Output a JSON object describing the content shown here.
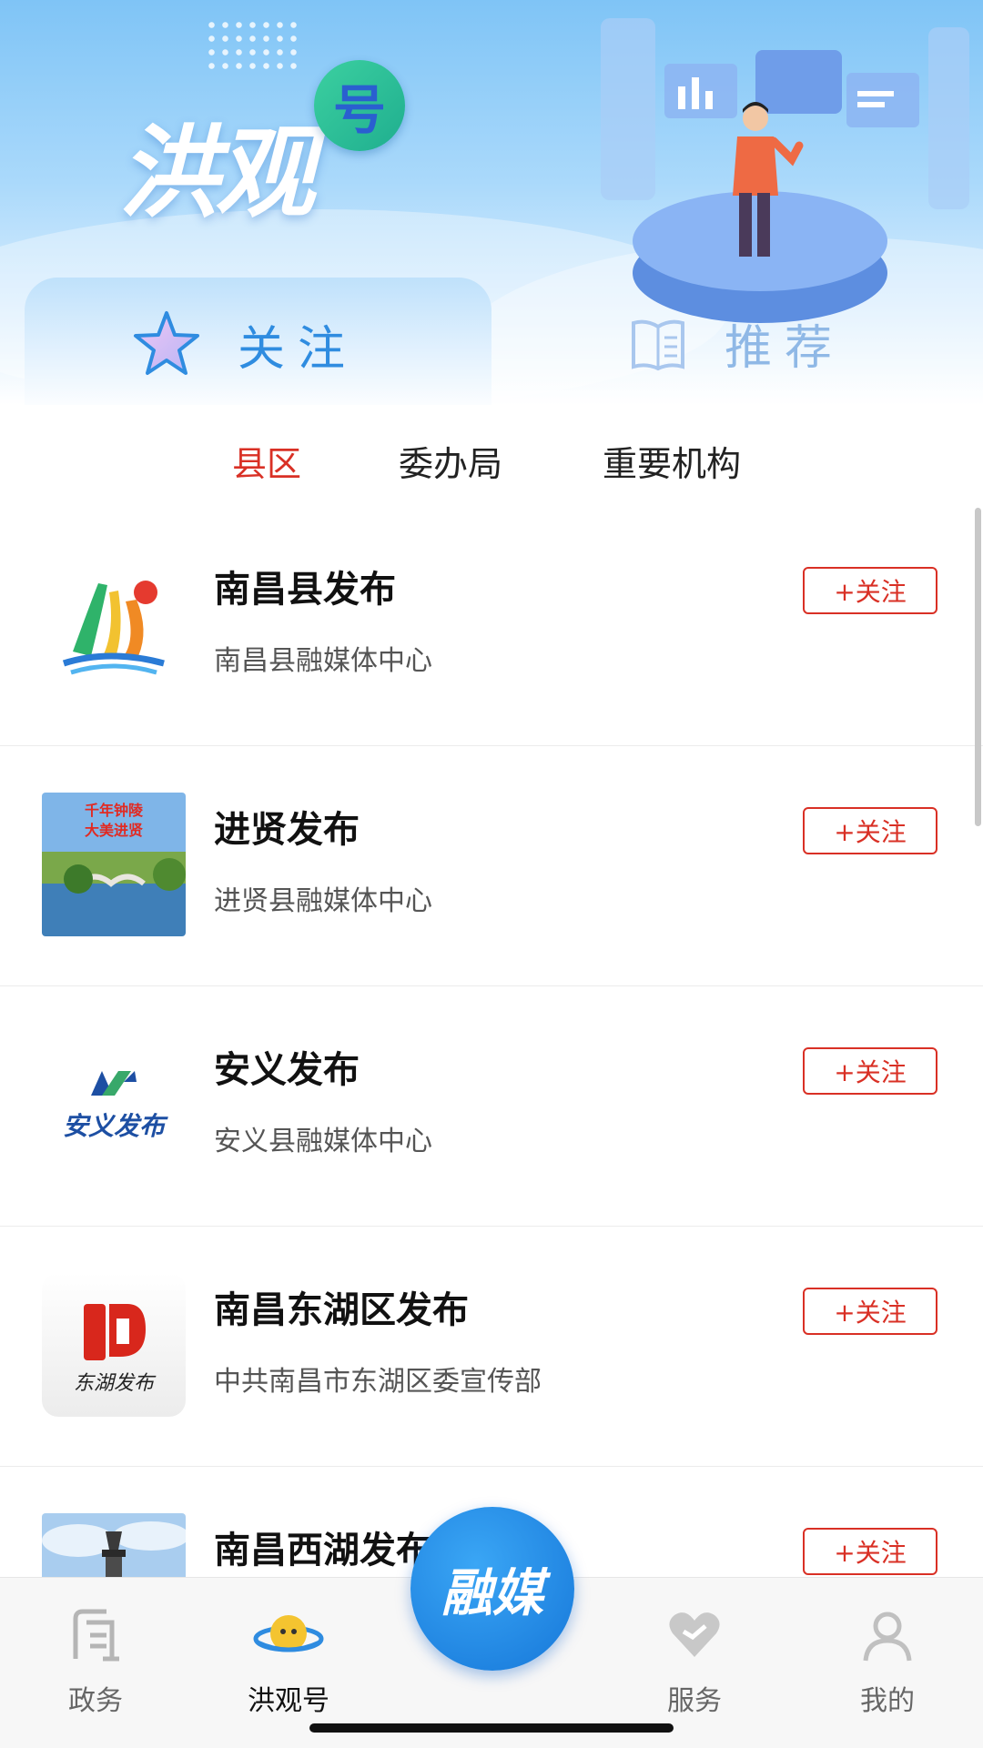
{
  "header": {
    "logo_text": "洪观",
    "logo_badge": "号",
    "tabs": [
      {
        "label": "关注",
        "icon": "star-icon",
        "active": true
      },
      {
        "label": "推荐",
        "icon": "book-icon",
        "active": false
      }
    ]
  },
  "subtabs": [
    {
      "label": "县区",
      "active": true
    },
    {
      "label": "委办局",
      "active": false
    },
    {
      "label": "重要机构",
      "active": false
    }
  ],
  "accounts": [
    {
      "name": "南昌县发布",
      "org": "南昌县融媒体中心",
      "button": "+关注",
      "logo": "nanchang-county-logo"
    },
    {
      "name": "进贤发布",
      "org": "进贤县融媒体中心",
      "button": "+关注",
      "logo": "jinxian-landscape-logo"
    },
    {
      "name": "安义发布",
      "org": "安义县融媒体中心",
      "button": "+关注",
      "logo": "anyi-logo",
      "logo_text": "安义发布"
    },
    {
      "name": "南昌东湖区发布",
      "org": "中共南昌市东湖区委宣传部",
      "button": "+关注",
      "logo": "donghu-logo",
      "logo_text": "东湖发布"
    },
    {
      "name": "南昌西湖发布",
      "org": "",
      "button": "+关注",
      "logo": "xihu-pagoda-logo"
    }
  ],
  "bottom_nav": {
    "items": [
      {
        "label": "政务",
        "icon": "government-icon"
      },
      {
        "label": "洪观号",
        "icon": "planet-icon",
        "active": true
      },
      {
        "label": "服务",
        "icon": "heart-icon"
      },
      {
        "label": "我的",
        "icon": "user-icon"
      }
    ],
    "center": {
      "label": "融媒",
      "icon": "rongmei-center-icon"
    }
  },
  "colors": {
    "accent_red": "#d93025",
    "tab_blue": "#2f8ce0",
    "center_blue": "#1677d9"
  },
  "jinxian_logo_text": [
    "千年钟陵",
    "大美进贤"
  ]
}
